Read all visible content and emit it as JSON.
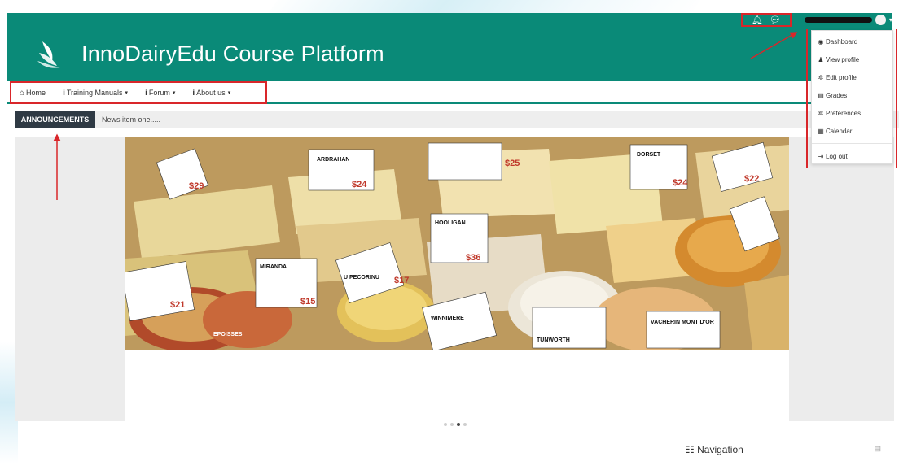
{
  "site": {
    "title": "InnoDairyEdu Course Platform"
  },
  "topbar": {
    "icons": [
      "bell-icon",
      "chat-icon"
    ],
    "user_caret": "▾"
  },
  "nav": {
    "items": [
      {
        "icon": "home-icon",
        "glyph": "⌂",
        "label": "Home",
        "has_caret": false
      },
      {
        "icon": "info-icon",
        "glyph": "i",
        "label": "Training Manuals",
        "has_caret": true
      },
      {
        "icon": "info-icon",
        "glyph": "i",
        "label": "Forum",
        "has_caret": true
      },
      {
        "icon": "info-icon",
        "glyph": "i",
        "label": "About us",
        "has_caret": true
      }
    ],
    "caret": "▾"
  },
  "announcements": {
    "label": "ANNOUNCEMENTS",
    "text": "News item one....."
  },
  "carousel": {
    "dot_count": 4,
    "active_index": 2
  },
  "hero": {
    "labels": [
      "ARDRAHAN",
      "DORSET",
      "HOOLIGAN",
      "MIRANDA",
      "U PECORINU",
      "WINNIMERE",
      "TUNWORTH",
      "VACHERIN MONT D'OR",
      "EPOISSES",
      "$24",
      "$25",
      "$36",
      "$15",
      "$17",
      "$21",
      "$29",
      "$22",
      "$24"
    ]
  },
  "blocks": {
    "navigation_title": "Navigation"
  },
  "user_menu": {
    "items": [
      {
        "icon": "dashboard-icon",
        "glyph": "◉",
        "label": "Dashboard"
      },
      {
        "icon": "user-icon",
        "glyph": "♟",
        "label": "View profile"
      },
      {
        "icon": "gear-icon",
        "glyph": "✲",
        "label": "Edit profile"
      },
      {
        "icon": "grades-icon",
        "glyph": "▤",
        "label": "Grades"
      },
      {
        "icon": "gear-icon",
        "glyph": "✲",
        "label": "Preferences"
      },
      {
        "icon": "calendar-icon",
        "glyph": "▦",
        "label": "Calendar"
      },
      {
        "icon": "logout-icon",
        "glyph": "⇥",
        "label": "Log out"
      }
    ]
  },
  "colors": {
    "brand": "#0a8a78",
    "annotation_red": "#d9262a",
    "announcement_label_bg": "#2f3a44"
  }
}
